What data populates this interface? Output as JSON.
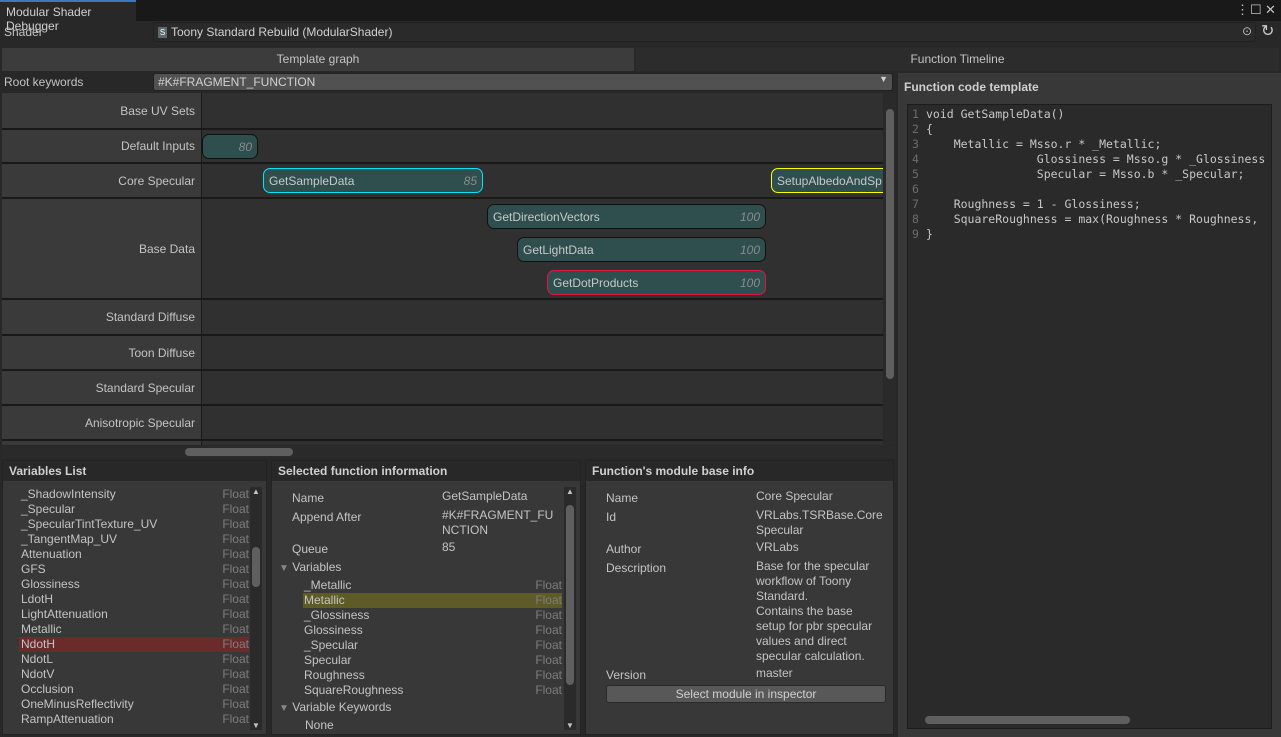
{
  "window": {
    "tab_title": "Modular Shader Debugger"
  },
  "shader": {
    "label": "Shader",
    "value": "Toony Standard Rebuild (ModularShader)"
  },
  "tabs": [
    {
      "label": "Template graph",
      "selected": true
    },
    {
      "label": "Function Timeline",
      "selected": false
    }
  ],
  "root_keywords": {
    "label": "Root keywords",
    "value": "#K#FRAGMENT_FUNCTION"
  },
  "graph": {
    "rows": [
      "Base UV Sets",
      "Default Inputs",
      "Core Specular",
      "Base Data",
      "Standard Diffuse",
      "Toon Diffuse",
      "Standard Specular",
      "Anisotropic Specular"
    ],
    "nodes": [
      {
        "name": "",
        "queue": "80",
        "row": "Default Inputs"
      },
      {
        "name": "GetSampleData",
        "queue": "85",
        "row": "Core Specular",
        "border": "#00e5ff"
      },
      {
        "name": "SetupAlbedoAndSp",
        "queue": "",
        "row": "Core Specular",
        "border": "#ffff00"
      },
      {
        "name": "GetDirectionVectors",
        "queue": "100",
        "row": "Base Data"
      },
      {
        "name": "GetLightData",
        "queue": "100",
        "row": "Base Data"
      },
      {
        "name": "GetDotProducts",
        "queue": "100",
        "row": "Base Data",
        "border": "#e0163c"
      }
    ]
  },
  "code_panel": {
    "title": "Function code template",
    "lines": [
      "void GetSampleData()",
      "{",
      "    Metallic = Msso.r * _Metallic;",
      "                Glossiness = Msso.g * _Glossiness",
      "                Specular = Msso.b * _Specular;",
      "",
      "    Roughness = 1 - Glossiness;",
      "    SquareRoughness = max(Roughness * Roughness,",
      "}"
    ]
  },
  "variables_list": {
    "title": "Variables List",
    "items": [
      {
        "name": "_ShadowIntensity",
        "type": "Float"
      },
      {
        "name": "_Specular",
        "type": "Float"
      },
      {
        "name": "_SpecularTintTexture_UV",
        "type": "Float"
      },
      {
        "name": "_TangentMap_UV",
        "type": "Float"
      },
      {
        "name": "Attenuation",
        "type": "Float"
      },
      {
        "name": "GFS",
        "type": "Float"
      },
      {
        "name": "Glossiness",
        "type": "Float"
      },
      {
        "name": "LdotH",
        "type": "Float"
      },
      {
        "name": "LightAttenuation",
        "type": "Float"
      },
      {
        "name": "Metallic",
        "type": "Float"
      },
      {
        "name": "NdotH",
        "type": "Float",
        "highlighted": true
      },
      {
        "name": "NdotL",
        "type": "Float"
      },
      {
        "name": "NdotV",
        "type": "Float"
      },
      {
        "name": "Occlusion",
        "type": "Float"
      },
      {
        "name": "OneMinusReflectivity",
        "type": "Float"
      },
      {
        "name": "RampAttenuation",
        "type": "Float"
      }
    ]
  },
  "selected_function": {
    "title": "Selected function information",
    "name_label": "Name",
    "name": "GetSampleData",
    "append_label": "Append After",
    "append_1": "#K#FRAGMENT_FU",
    "append_2": "NCTION",
    "queue_label": "Queue",
    "queue": "85",
    "variables_label": "Variables",
    "variables": [
      {
        "name": "_Metallic",
        "type": "Float"
      },
      {
        "name": "Metallic",
        "type": "Float",
        "highlighted": true
      },
      {
        "name": "_Glossiness",
        "type": "Float"
      },
      {
        "name": "Glossiness",
        "type": "Float"
      },
      {
        "name": "_Specular",
        "type": "Float"
      },
      {
        "name": "Specular",
        "type": "Float"
      },
      {
        "name": "Roughness",
        "type": "Float"
      },
      {
        "name": "SquareRoughness",
        "type": "Float"
      }
    ],
    "keywords_label": "Variable Keywords",
    "keywords": "None"
  },
  "module_info": {
    "title": "Function's module base info",
    "name_label": "Name",
    "name": "Core Specular",
    "id_label": "Id",
    "id_1": "VRLabs.TSRBase.Core",
    "id_2": "Specular",
    "author_label": "Author",
    "author": "VRLabs",
    "description_label": "Description",
    "description": [
      "Base for the specular",
      "workflow of Toony",
      "Standard.",
      "Contains the base",
      "setup for pbr specular",
      "values and direct",
      "specular calculation."
    ],
    "version_label": "Version",
    "version": "master",
    "select_button": "Select module in inspector"
  },
  "colors": {
    "accent": "#3a79bb",
    "node_fill": "#2f4f4f",
    "var_highlight": "#6a2b2b",
    "selected_var_highlight": "#5f5b26"
  }
}
